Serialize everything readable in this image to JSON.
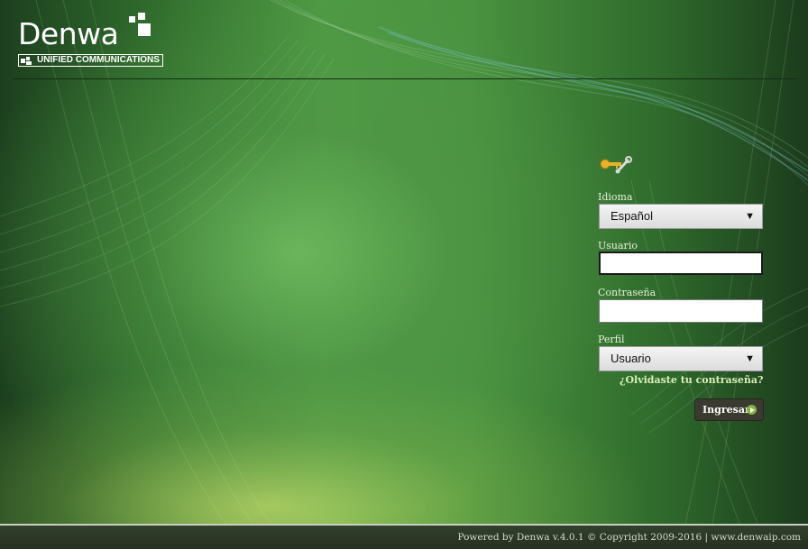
{
  "brand": {
    "logo_word": "Denwa",
    "logo_tagline": "UNIFIED COMMUNICATIONS"
  },
  "login": {
    "icon": "keys-icon",
    "language": {
      "label": "Idioma",
      "selected": "Español"
    },
    "username": {
      "label": "Usuario",
      "value": ""
    },
    "password": {
      "label": "Contraseña",
      "value": ""
    },
    "profile": {
      "label": "Perfil",
      "selected": "Usuario"
    },
    "forgot_link": "¿Olvidaste tu contraseña?",
    "submit_label": "Ingresar"
  },
  "footer": {
    "text": "Powered by Denwa v.4.0.1 © Copyright 2009-2016 | www.denwaip.com"
  },
  "colors": {
    "background_green": "#4f9a44",
    "footer_bg": "#2c3826",
    "button_bg": "#3a3a30",
    "button_icon": "#7fb63d"
  }
}
